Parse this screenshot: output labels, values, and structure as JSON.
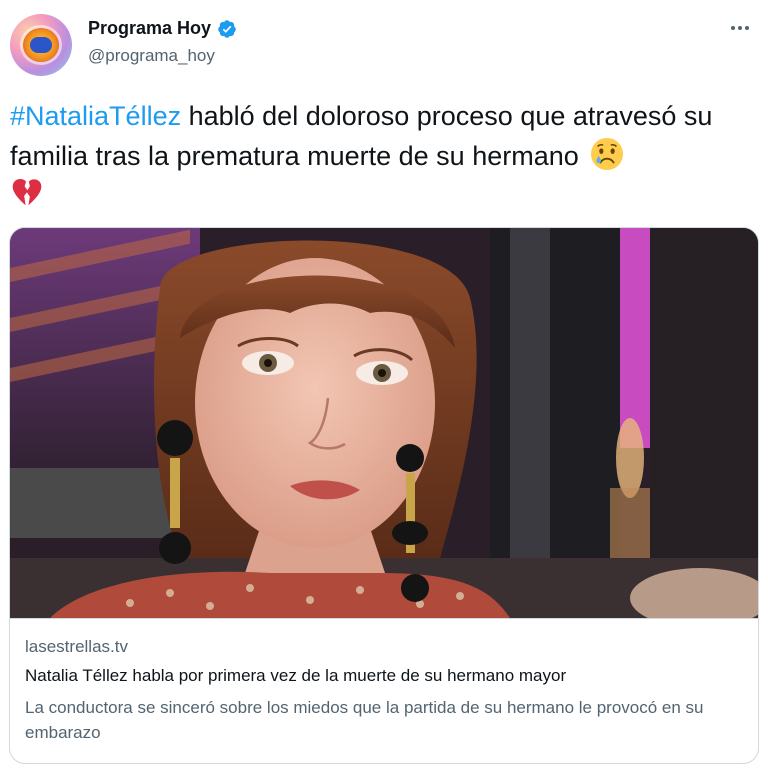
{
  "author": {
    "display_name": "Programa Hoy",
    "handle": "@programa_hoy",
    "verified": true,
    "avatar_icon": "programa-hoy-logo"
  },
  "tweet": {
    "hashtag": "#NataliaTéllez",
    "text": " habló del doloroso proceso que atravesó su familia tras la prematura muerte de su hermano",
    "emojis": [
      "crying-face-emoji",
      "broken-heart-emoji"
    ]
  },
  "card": {
    "image_description_icon": "article-photo",
    "domain": "lasestrellas.tv",
    "title": "Natalia Téllez habla por primera vez de la muerte de su hermano mayor",
    "description": "La conductora se sinceró sobre los miedos que la partida de su hermano le provocó en su embarazo"
  },
  "colors": {
    "link_blue": "#1d9bf0",
    "secondary_text": "#536471",
    "primary_text": "#0f1419",
    "border": "#cfd9de"
  }
}
